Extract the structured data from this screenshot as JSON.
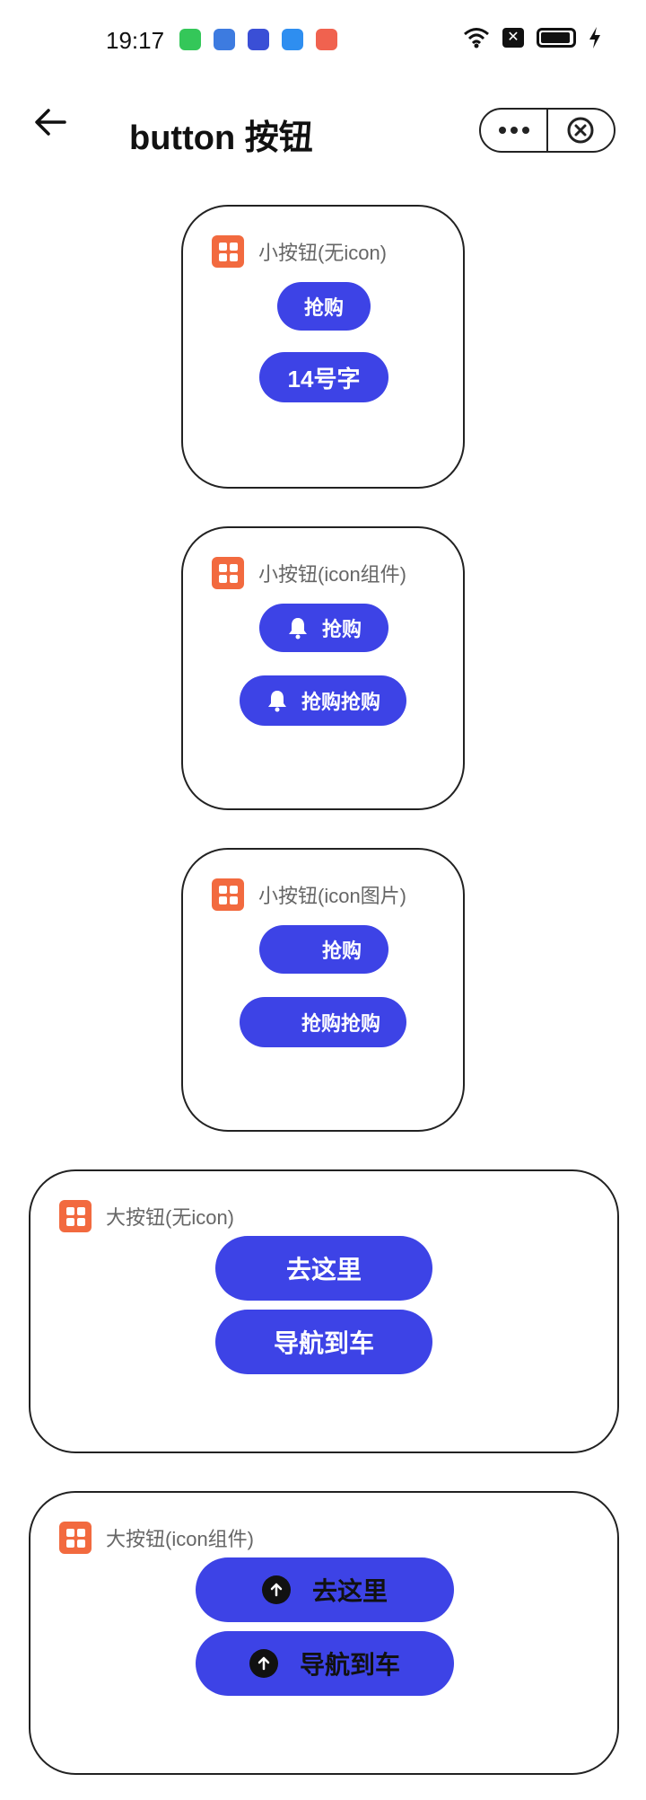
{
  "status_bar": {
    "time": "19:17",
    "app_icons": [
      {
        "name": "app-green-icon",
        "color": "#34c759"
      },
      {
        "name": "app-blue-infinity-icon",
        "color": "#3d7be0"
      },
      {
        "name": "app-photo-icon",
        "color": "#3a4fd6"
      },
      {
        "name": "app-cloud-icon",
        "color": "#2e8ef0"
      },
      {
        "name": "app-game-icon",
        "color": "#f0624f"
      }
    ]
  },
  "nav": {
    "title": "button 按钮"
  },
  "cards": [
    {
      "title": "小按钮(无icon)",
      "buttons": [
        "抢购",
        "14号字"
      ]
    },
    {
      "title": "小按钮(icon组件)",
      "buttons": [
        "抢购",
        "抢购抢购"
      ]
    },
    {
      "title": "小按钮(icon图片)",
      "buttons": [
        "抢购",
        "抢购抢购"
      ]
    },
    {
      "title": "大按钮(无icon)",
      "buttons": [
        "去这里",
        "导航到车"
      ]
    },
    {
      "title": "大按钮(icon组件)",
      "buttons": [
        "去这里",
        "导航到车"
      ]
    }
  ],
  "colors": {
    "button_bg": "#3d43e6",
    "logo_bg": "#f26a3f",
    "card_border": "#222222"
  }
}
